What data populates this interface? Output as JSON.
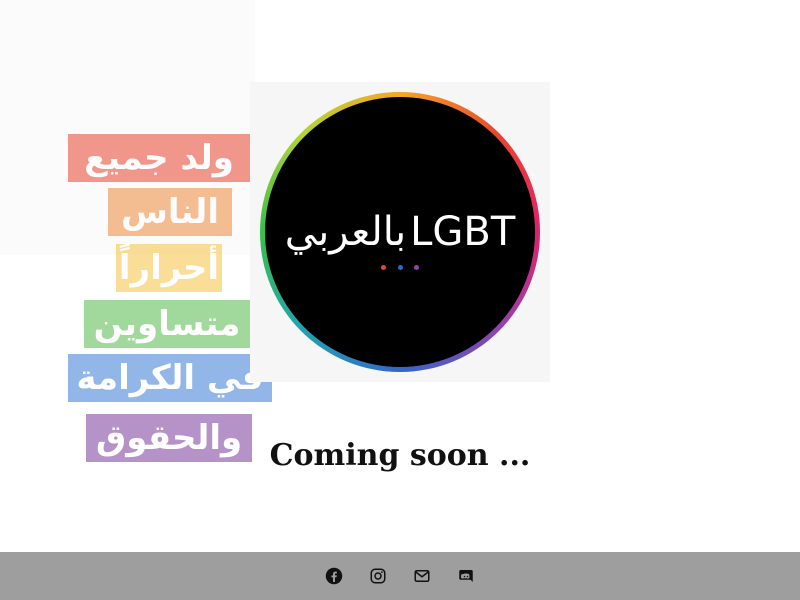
{
  "logo": {
    "latin": "LGBT",
    "arabic": "بالعربي",
    "ring_colors": [
      "#f6a623",
      "#e9452f",
      "#e0226b",
      "#8e44ad",
      "#3466c9",
      "#1fa3b3",
      "#3bbf4a",
      "#b3d334"
    ],
    "dot_colors": [
      "#e9452f",
      "#3466c9",
      "#8e44ad"
    ]
  },
  "poster": {
    "lines": [
      {
        "text": "ولد جميع",
        "color": "#e9452f"
      },
      {
        "text": "الناس",
        "color": "#f08a3c"
      },
      {
        "text": "أحراراً",
        "color": "#f6c343"
      },
      {
        "text": "متساوين",
        "color": "#55b94a"
      },
      {
        "text": "في الكرامة",
        "color": "#3a7bd5"
      },
      {
        "text": "والحقوق",
        "color": "#7a3a9a"
      }
    ]
  },
  "main": {
    "heading": "Coming soon ..."
  },
  "footer": {
    "icons": [
      "facebook-icon",
      "instagram-icon",
      "email-icon",
      "discord-icon"
    ]
  }
}
